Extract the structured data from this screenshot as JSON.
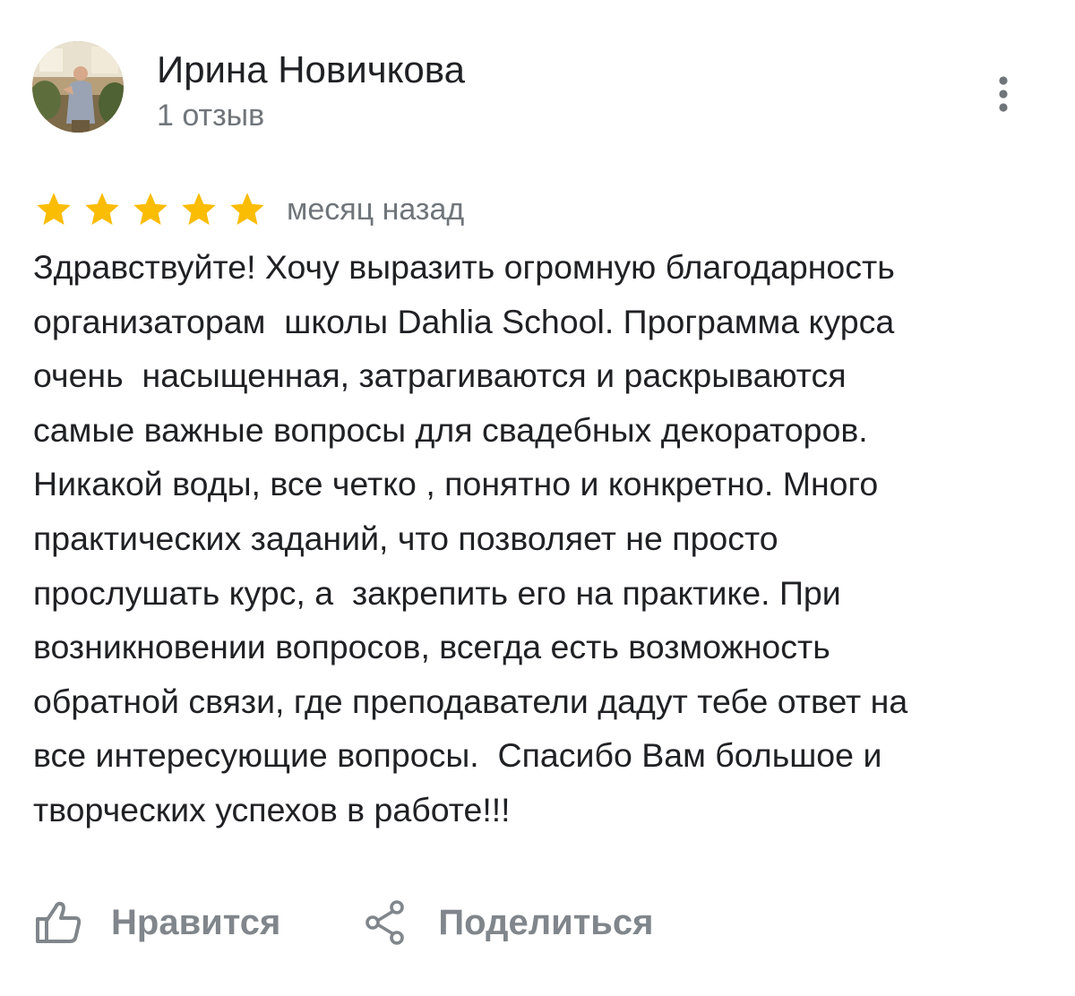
{
  "review": {
    "author": {
      "name": "Ирина Новичкова",
      "review_count_label": "1 отзыв",
      "avatar_icon": "user-photo-avatar"
    },
    "menu_icon": "more-vert-icon",
    "rating": {
      "value": 5,
      "max": 5,
      "star_color": "#fbbc04"
    },
    "date_label": "месяц назад",
    "text_lines": [
      "Здравствуйте! Хочу выразить огромную благодарность",
      "организаторам  школы Dahlia School. Программа курса",
      "очень  насыщенная, затрагиваются и раскрываются",
      "самые важные вопросы для свадебных декораторов.",
      "Никакой воды, все четко , понятно и конкретно. Много",
      "практических заданий, что позволяет не просто",
      "прослушать курс, а  закрепить его на практике. При",
      "возникновении вопросов, всегда есть возможность",
      "обратной связи, где преподаватели дадут тебе ответ на",
      "все интересующие вопросы.  Спасибо Вам большое и",
      "творческих успехов в работе!!!"
    ]
  },
  "actions": {
    "like": {
      "label": "Нравится",
      "icon": "thumb-up-icon"
    },
    "share": {
      "label": "Поделиться",
      "icon": "share-icon"
    }
  },
  "colors": {
    "primary_text": "#202124",
    "secondary_text": "#70757a",
    "action_text": "#80868b",
    "star": "#fbbc04"
  }
}
